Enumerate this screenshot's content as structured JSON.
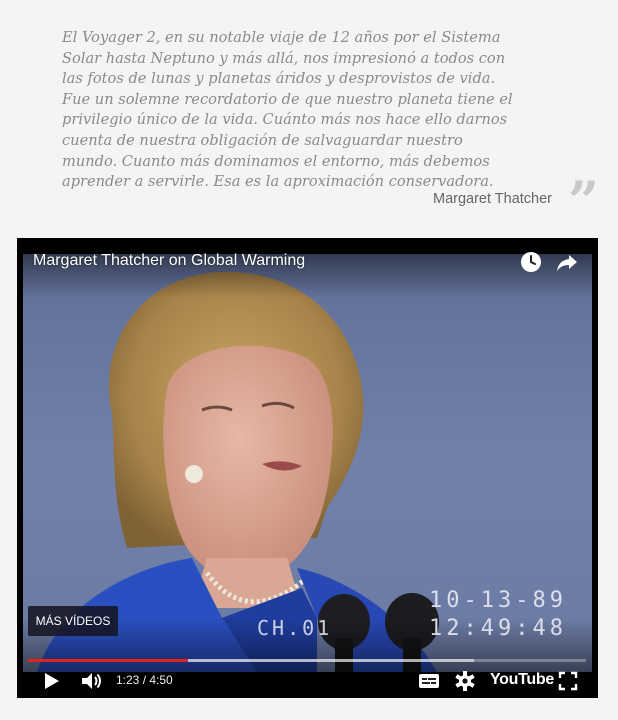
{
  "quote": {
    "lines": [
      "El Voyager 2, en su notable viaje de 12 años por el Sistema",
      "Solar hasta Neptuno y más allá, nos impresionó a todos con",
      "las fotos de lunas y planetas áridos y desprovistos de vida.",
      "Fue un solemne recordatorio de que nuestro planeta tiene el",
      "privilegio único de la vida. Cuánto más nos hace ello darnos",
      "cuenta de nuestra obligación de salvaguardar nuestro",
      "mundo. Cuanto más dominamos el entorno, más debemos",
      "aprender a servirle. Esa es la aproximación conservadora."
    ],
    "author": "Margaret Thatcher",
    "closing_mark": "”"
  },
  "player": {
    "title": "Margaret Thatcher on Global Warming",
    "more_videos_label": "MÁS VÍDEOS",
    "time_current": "1:23",
    "time_separator": " / ",
    "time_total": "4:50",
    "progress_played": 0.287,
    "progress_buffered": 0.8,
    "logo_text": "YouTube",
    "timestamp_overlay": {
      "date": "10-13-89",
      "channel": "CH.01",
      "time": "12:49:48"
    },
    "colors": {
      "progress": "#e62117",
      "backdrop": "#6f7fa6",
      "jacket": "#2a4fc0"
    },
    "icons": [
      "watch-later-icon",
      "share-icon",
      "play-icon",
      "volume-icon",
      "subtitles-icon",
      "settings-icon",
      "fullscreen-icon"
    ]
  }
}
